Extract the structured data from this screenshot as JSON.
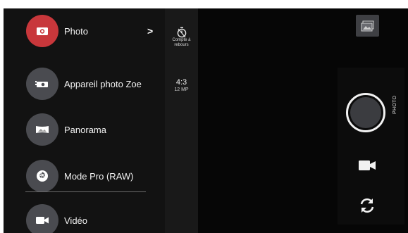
{
  "modes": [
    {
      "label": "Photo",
      "icon": "camera-icon",
      "active": true,
      "has_submenu": true
    },
    {
      "label": "Appareil photo Zoe",
      "icon": "zoe-camera-icon",
      "active": false
    },
    {
      "label": "Panorama",
      "icon": "panorama-icon",
      "active": false
    },
    {
      "label": "Mode Pro (RAW)",
      "icon": "aperture-icon",
      "active": false
    },
    {
      "label": "Vidéo",
      "icon": "video-camera-icon",
      "active": false
    }
  ],
  "chevron": ">",
  "settings": {
    "timer_label_line1": "Compte à",
    "timer_label_line2": "rebours",
    "aspect_ratio": "4:3",
    "resolution": "12 MP"
  },
  "shutter_mode_label": "PHOTO",
  "colors": {
    "active_mode": "#c8373b",
    "inactive_mode": "#4a4b50",
    "background": "#050505"
  }
}
